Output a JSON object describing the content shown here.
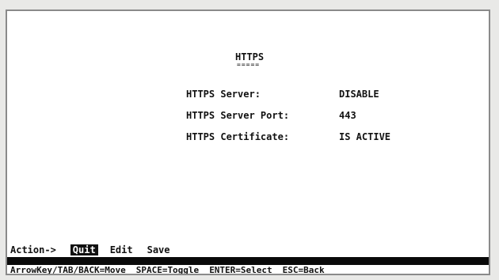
{
  "screen": {
    "title": "HTTPS",
    "title_underline": "=====",
    "settings": [
      {
        "label": "HTTPS Server:",
        "value": "DISABLE"
      },
      {
        "label": "HTTPS Server Port:",
        "value": "443"
      },
      {
        "label": "HTTPS Certificate:",
        "value": "IS ACTIVE"
      }
    ]
  },
  "action_bar": {
    "label": "Action->",
    "items": [
      {
        "label": "Quit",
        "selected": true
      },
      {
        "label": "Edit",
        "selected": false
      },
      {
        "label": "Save",
        "selected": false
      }
    ]
  },
  "help_bar": {
    "items": [
      "ArrowKey/TAB/BACK=Move",
      "SPACE=Toggle",
      "ENTER=Select",
      "ESC=Back"
    ]
  },
  "colors": {
    "background": "#ffffff",
    "text": "#111111",
    "bar": "#0a0a0a",
    "selected_bg": "#111111",
    "selected_fg": "#ffffff"
  }
}
